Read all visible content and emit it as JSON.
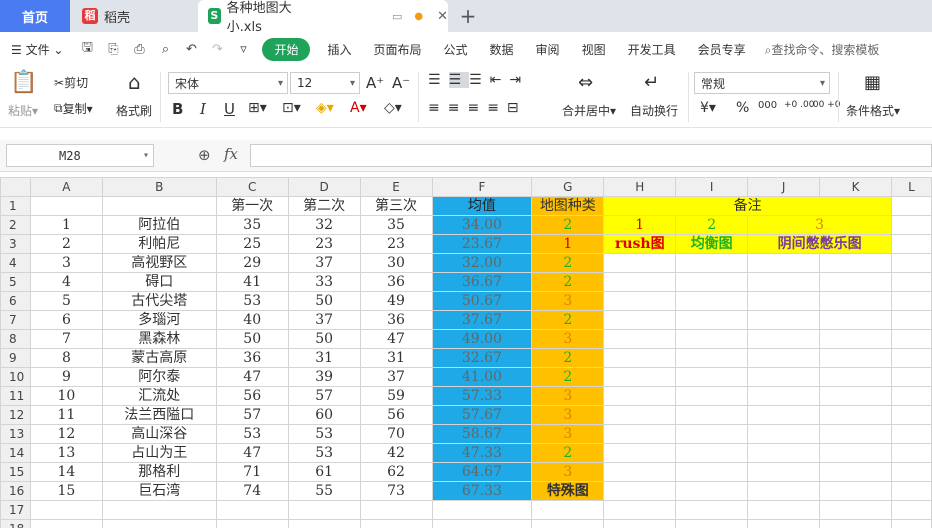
{
  "tabs": {
    "home": "首页",
    "daoke": "稻壳",
    "file": "各种地图大小.xls"
  },
  "menu": {
    "file": "文件",
    "items": [
      "开始",
      "插入",
      "页面布局",
      "公式",
      "数据",
      "审阅",
      "视图",
      "开发工具",
      "会员专享"
    ],
    "search": "查找命令、搜索模板"
  },
  "ribbon": {
    "paste": "粘贴",
    "cut": "剪切",
    "copy": "复制",
    "format_painter": "格式刷",
    "font": "宋体",
    "size": "12",
    "merge": "合并居中",
    "wrap": "自动换行",
    "numfmt": "常规",
    "cond": "条件格式",
    "currency": "¥",
    "percent": "%",
    "thousands": "000",
    "inc_dec": "+0 .00",
    "dec_dec": ".00 +0"
  },
  "formula": {
    "cell_ref": "M28",
    "fx": "fx"
  },
  "columns": [
    "A",
    "B",
    "C",
    "D",
    "E",
    "F",
    "G",
    "H",
    "I",
    "J",
    "K",
    "L"
  ],
  "header_row": {
    "c": "第一次",
    "d": "第二次",
    "e": "第三次",
    "f": "均值",
    "g": "地图种类",
    "notes": "备注"
  },
  "legend": {
    "v1": "1",
    "v2": "2",
    "v3": "3",
    "l1": "rush图",
    "l2": "均衡图",
    "l3": "阴间憋憋乐图"
  },
  "rows": [
    {
      "n": "1",
      "a": "1",
      "b": "阿拉伯",
      "c": "35",
      "d": "32",
      "e": "35",
      "f": "34.00",
      "g": "2"
    },
    {
      "n": "2",
      "a": "2",
      "b": "利帕尼",
      "c": "25",
      "d": "23",
      "e": "23",
      "f": "23.67",
      "g": "1"
    },
    {
      "n": "3",
      "a": "3",
      "b": "高视野区",
      "c": "29",
      "d": "37",
      "e": "30",
      "f": "32.00",
      "g": "2"
    },
    {
      "n": "4",
      "a": "4",
      "b": "碍口",
      "c": "41",
      "d": "33",
      "e": "36",
      "f": "36.67",
      "g": "2"
    },
    {
      "n": "5",
      "a": "5",
      "b": "古代尖塔",
      "c": "53",
      "d": "50",
      "e": "49",
      "f": "50.67",
      "g": "3"
    },
    {
      "n": "6",
      "a": "6",
      "b": "多瑙河",
      "c": "40",
      "d": "37",
      "e": "36",
      "f": "37.67",
      "g": "2"
    },
    {
      "n": "7",
      "a": "7",
      "b": "黑森林",
      "c": "50",
      "d": "50",
      "e": "47",
      "f": "49.00",
      "g": "3"
    },
    {
      "n": "8",
      "a": "8",
      "b": "蒙古高原",
      "c": "36",
      "d": "31",
      "e": "31",
      "f": "32.67",
      "g": "2"
    },
    {
      "n": "9",
      "a": "9",
      "b": "阿尔泰",
      "c": "47",
      "d": "39",
      "e": "37",
      "f": "41.00",
      "g": "2"
    },
    {
      "n": "10",
      "a": "10",
      "b": "汇流处",
      "c": "56",
      "d": "57",
      "e": "59",
      "f": "57.33",
      "g": "3"
    },
    {
      "n": "11",
      "a": "11",
      "b": "法兰西隘口",
      "c": "57",
      "d": "60",
      "e": "56",
      "f": "57.67",
      "g": "3"
    },
    {
      "n": "12",
      "a": "12",
      "b": "高山深谷",
      "c": "53",
      "d": "53",
      "e": "70",
      "f": "58.67",
      "g": "3"
    },
    {
      "n": "13",
      "a": "13",
      "b": "占山为王",
      "c": "47",
      "d": "53",
      "e": "42",
      "f": "47.33",
      "g": "2"
    },
    {
      "n": "14",
      "a": "14",
      "b": "那格利",
      "c": "71",
      "d": "61",
      "e": "62",
      "f": "64.67",
      "g": "3"
    },
    {
      "n": "15",
      "a": "15",
      "b": "巨石湾",
      "c": "74",
      "d": "55",
      "e": "73",
      "f": "67.33",
      "g": "特殊图"
    }
  ],
  "row_numbers": [
    "1",
    "2",
    "3",
    "4",
    "5",
    "6",
    "7",
    "8",
    "9",
    "10",
    "11",
    "12",
    "13",
    "14",
    "15",
    "16",
    "17",
    "18"
  ],
  "colors": {
    "brand": "#1fa35a",
    "avg": "#1fa9e6",
    "kind": "#ffc000",
    "notes": "#ffff00"
  }
}
